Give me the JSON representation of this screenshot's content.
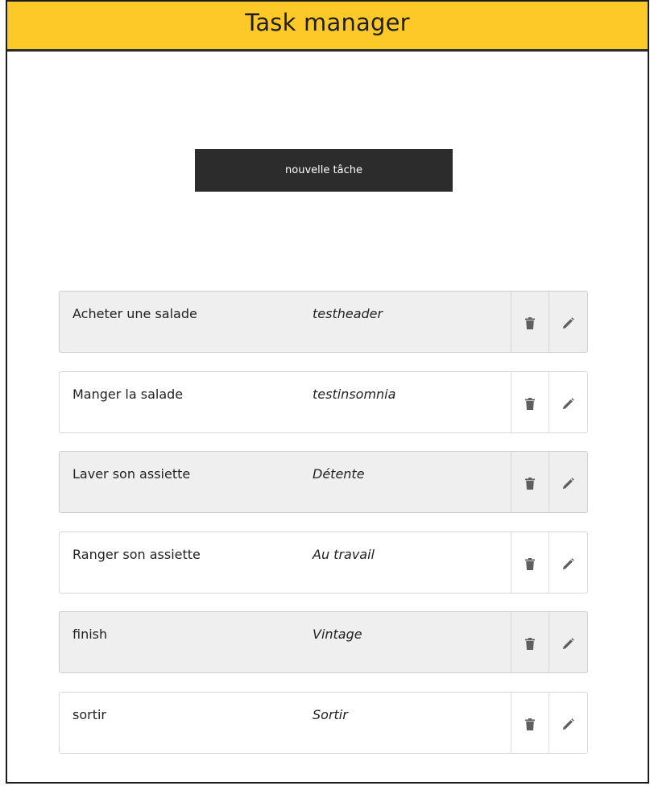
{
  "header": {
    "title": "Task manager"
  },
  "new_task_button": {
    "label": "nouvelle tâche"
  },
  "tasks": [
    {
      "title": "Acheter une salade",
      "category": "testheader"
    },
    {
      "title": "Manger la salade",
      "category": "testinsomnia"
    },
    {
      "title": "Laver son assiette",
      "category": "Détente"
    },
    {
      "title": "Ranger son assiette",
      "category": "Au travail"
    },
    {
      "title": "finish",
      "category": "Vintage"
    },
    {
      "title": "sortir",
      "category": "Sortir"
    }
  ],
  "icons": {
    "delete": "trash-icon",
    "edit": "pencil-icon"
  },
  "colors": {
    "header_bg": "#fdc928",
    "button_bg": "#2c2c2c",
    "row_shaded_bg": "#efefef",
    "icon_color": "#5f5f5f"
  }
}
